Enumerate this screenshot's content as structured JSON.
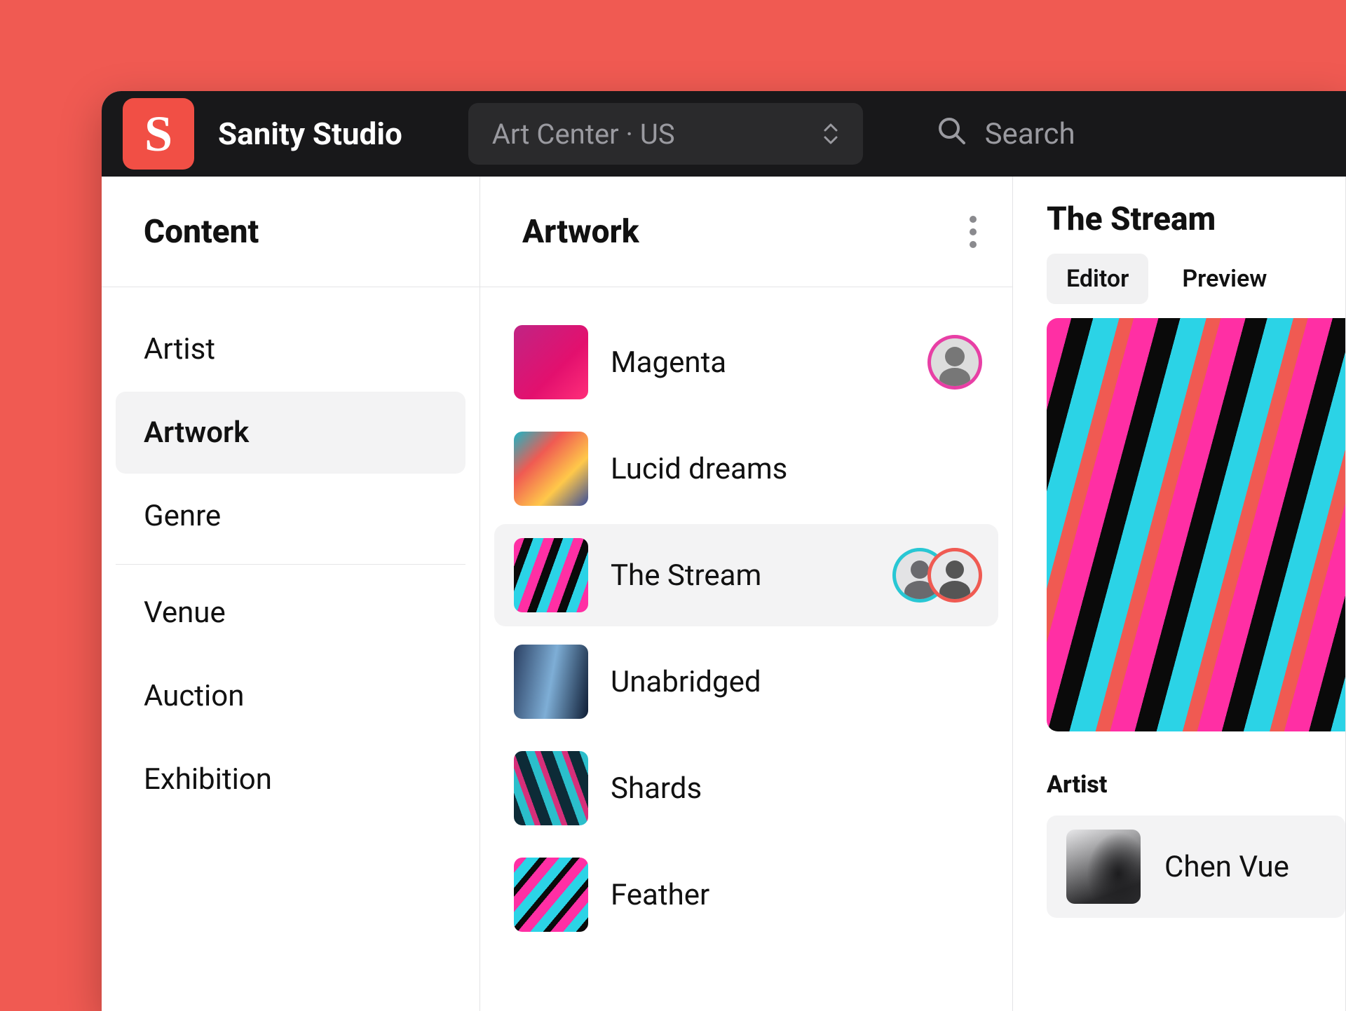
{
  "header": {
    "app_title": "Sanity Studio",
    "logo_letter": "S",
    "dataset_label": "Art Center · US",
    "search_placeholder": "Search"
  },
  "sidebar": {
    "title": "Content",
    "items": [
      {
        "label": "Artist",
        "active": false
      },
      {
        "label": "Artwork",
        "active": true
      },
      {
        "label": "Genre",
        "active": false
      },
      {
        "label": "Venue",
        "active": false
      },
      {
        "label": "Auction",
        "active": false
      },
      {
        "label": "Exhibition",
        "active": false
      }
    ]
  },
  "list": {
    "title": "Artwork",
    "items": [
      {
        "label": "Magenta",
        "thumb": "th-magenta",
        "active": false,
        "presence": [
          "pink"
        ]
      },
      {
        "label": "Lucid dreams",
        "thumb": "th-lucid",
        "active": false,
        "presence": []
      },
      {
        "label": "The Stream",
        "thumb": "th-stream",
        "active": true,
        "presence": [
          "teal",
          "coral"
        ]
      },
      {
        "label": "Unabridged",
        "thumb": "th-unabr",
        "active": false,
        "presence": []
      },
      {
        "label": "Shards",
        "thumb": "th-shards",
        "active": false,
        "presence": []
      },
      {
        "label": "Feather",
        "thumb": "th-feather",
        "active": false,
        "presence": []
      }
    ]
  },
  "document": {
    "title": "The Stream",
    "tabs": [
      {
        "label": "Editor",
        "active": true
      },
      {
        "label": "Preview",
        "active": false
      }
    ],
    "artist_field_label": "Artist",
    "artist_name": "Chen Vue"
  }
}
